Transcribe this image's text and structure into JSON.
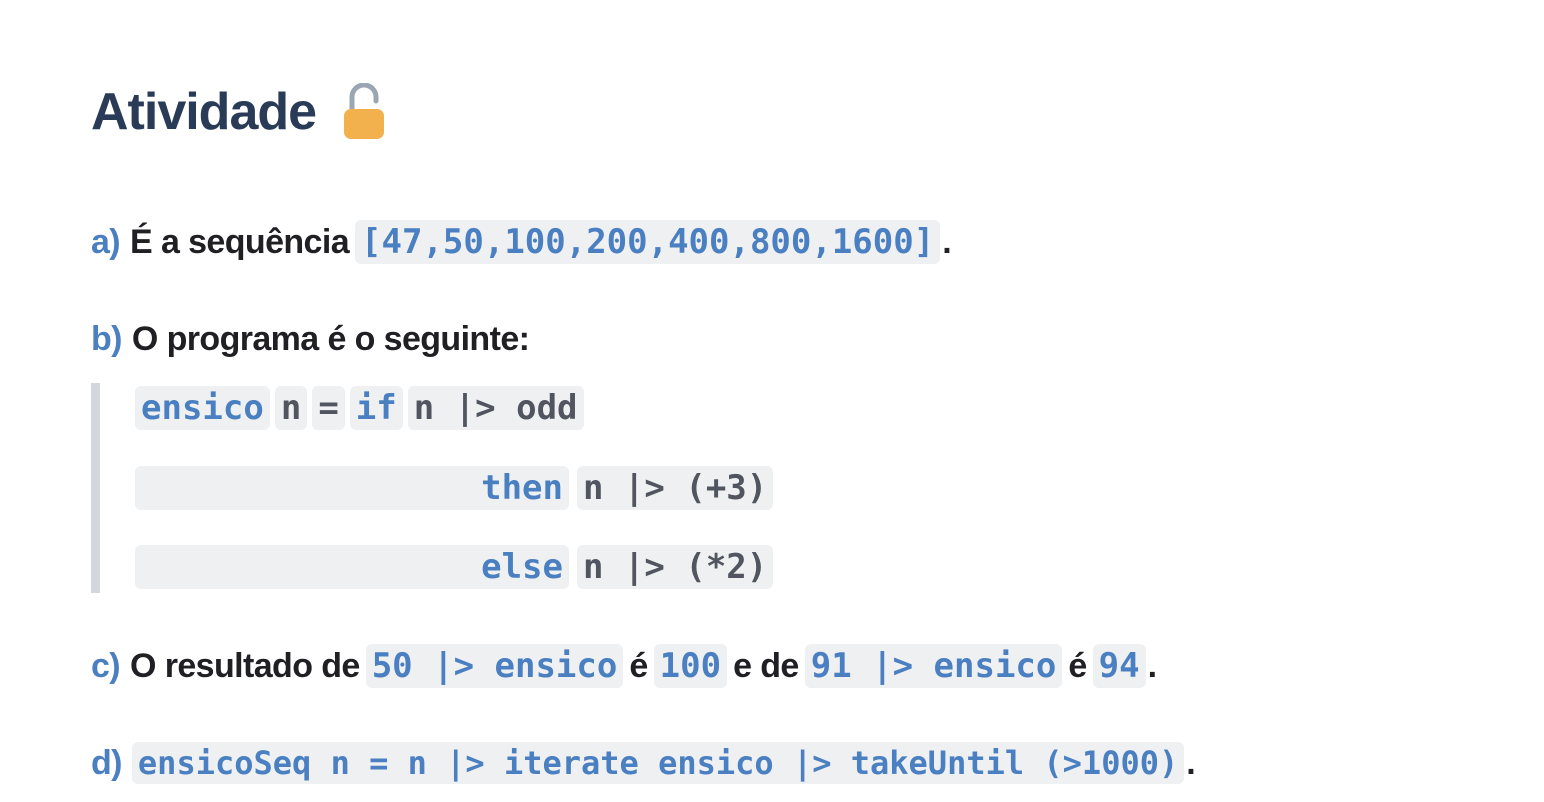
{
  "title": "Atividade",
  "title_icon": "open-lock-icon",
  "colors": {
    "accent": "#4a7fc1",
    "heading": "#2a3b57",
    "code_bg": "#eff0f2",
    "lock": "#f2b14c"
  },
  "a": {
    "label": "a)",
    "text": "É a sequência",
    "code": "[47,50,100,200,400,800,1600]",
    "end": "."
  },
  "b": {
    "label": "b)",
    "text": "O programa é o seguinte:",
    "code_lines": [
      [
        "ensico",
        "n",
        "=",
        "if",
        "n |> odd"
      ],
      [
        "then",
        "n |> (+3)"
      ],
      [
        "else",
        "n |> (*2)"
      ]
    ]
  },
  "c": {
    "label": "c)",
    "t1": "O resultado de",
    "code1": "50 |> ensico",
    "t2": "é",
    "code2": "100",
    "t3": "e de",
    "code3": "91 |> ensico",
    "t4": "é",
    "code4": "94",
    "end": "."
  },
  "d": {
    "label": "d)",
    "code": "ensicoSeq n = n |> iterate ensico |> takeUntil (>1000)",
    "end": "."
  }
}
